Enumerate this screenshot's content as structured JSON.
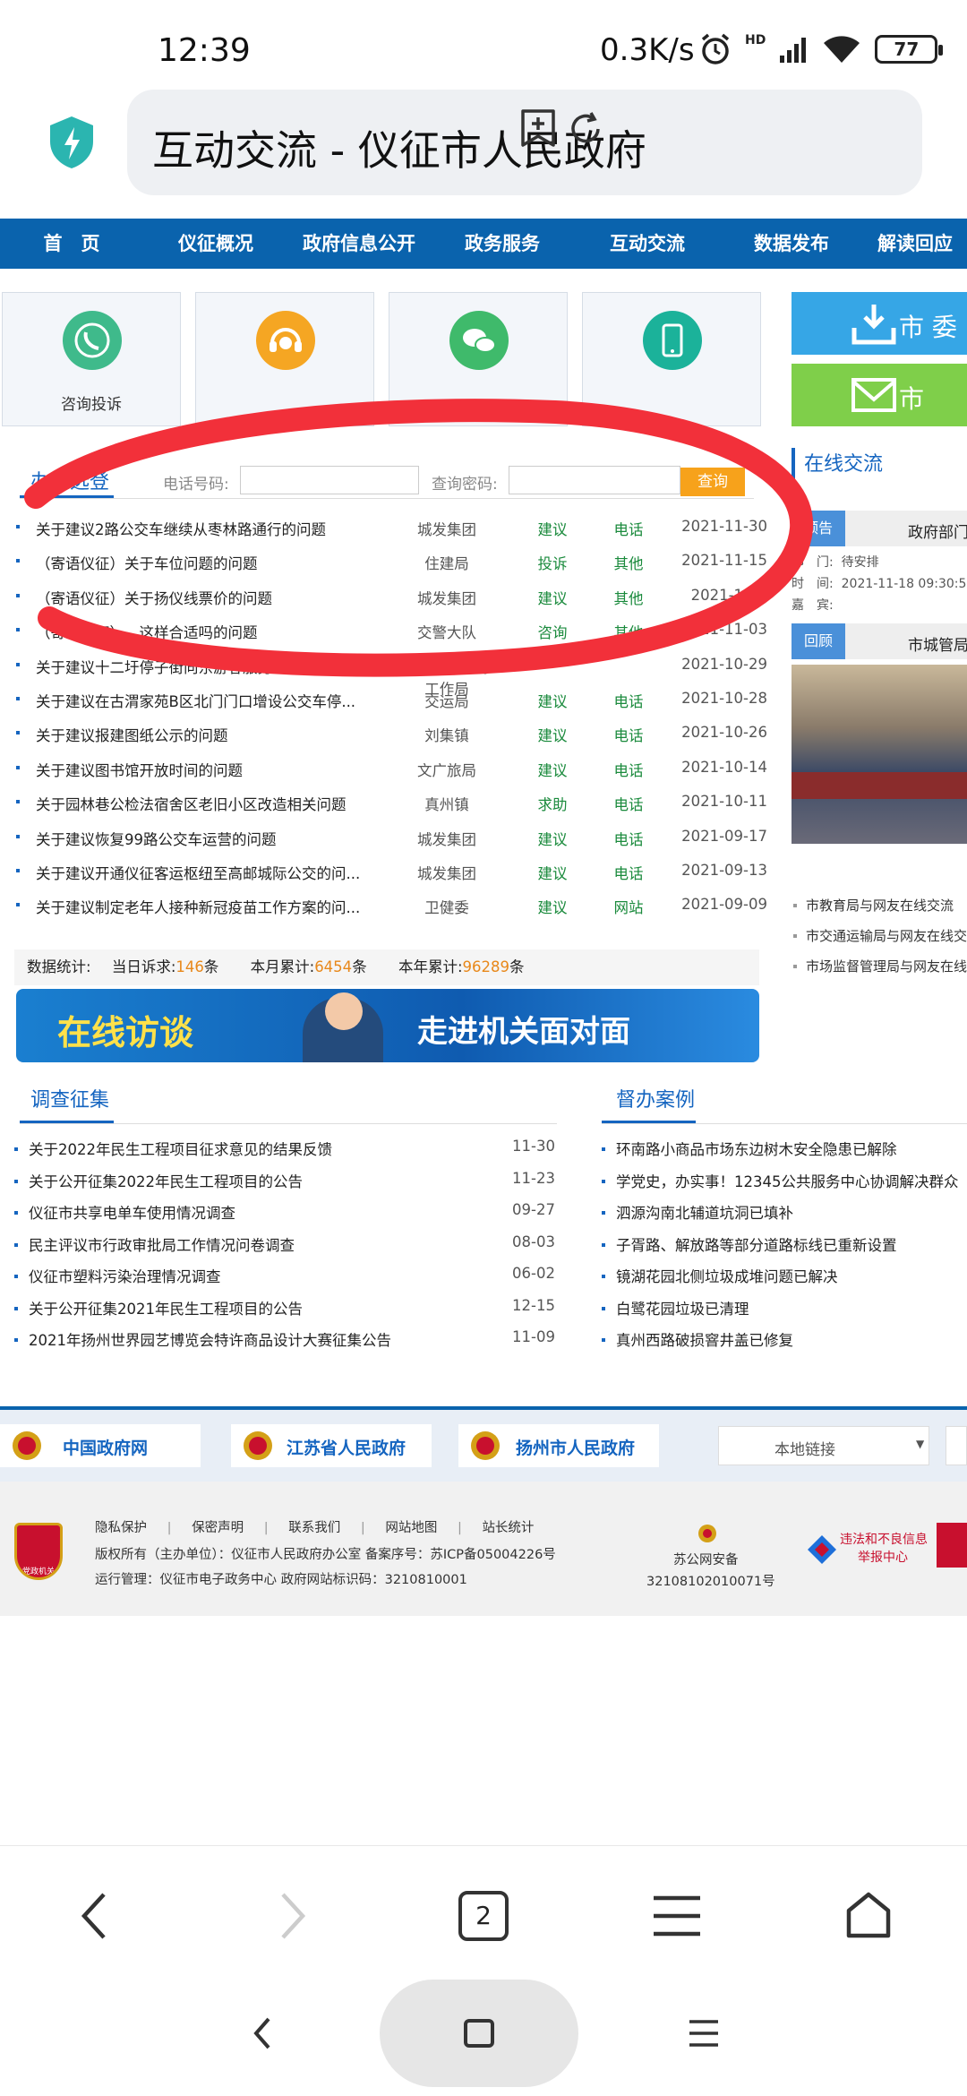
{
  "status": {
    "time": "12:39",
    "net_speed": "0.3K/s",
    "hd": "HD",
    "battery": "77"
  },
  "browser": {
    "title": "互动交流 - 仪征市人民政府",
    "tab_count": "2"
  },
  "nav": [
    "首　页",
    "仪征概况",
    "政府信息公开",
    "政务服务",
    "互动交流",
    "数据发布",
    "解读回应"
  ],
  "tiles": [
    {
      "label": "咨询投诉",
      "color": "#3fba8b"
    },
    {
      "label": "",
      "color": "#f5a623"
    },
    {
      "label": "",
      "color": "#3fba6b"
    },
    {
      "label": "",
      "color": "#1bb29a"
    }
  ],
  "side_buttons": [
    {
      "label": "市 委",
      "color": "#36a6e6"
    },
    {
      "label": "市",
      "color": "#7fcf4a"
    }
  ],
  "office": {
    "title": "办件选登",
    "phone_label": "电话号码:",
    "pwd_label": "查询密码:",
    "query_button": "查询",
    "rows": [
      {
        "title": "关于建议2路公交车继续从枣林路通行的问题",
        "dept": "城发集团",
        "type": "建议",
        "channel": "电话",
        "date": "2021-11-30"
      },
      {
        "title": "（寄语仪征）关于车位问题的问题",
        "dept": "住建局",
        "type": "投诉",
        "channel": "其他",
        "date": "2021-11-15"
      },
      {
        "title": "（寄语仪征）关于扬仪线票价的问题",
        "dept": "城发集团",
        "type": "建议",
        "channel": "其他",
        "date": "2021-11-1"
      },
      {
        "title": "（寄语仪征）…这样合适吗的问题",
        "dept": "交警大队",
        "type": "咨询",
        "channel": "其他",
        "date": "2021-11-03"
      },
      {
        "title": "关于建议十二圩停子街向东游客服务中心…",
        "dept": "开发区十二圩工作局",
        "type": "",
        "channel": "",
        "date": "2021-10-29"
      },
      {
        "title": "关于建议在古渭家苑B区北门门口增设公交车停...",
        "dept": "交运局",
        "type": "建议",
        "channel": "电话",
        "date": "2021-10-28"
      },
      {
        "title": "关于建议报建图纸公示的问题",
        "dept": "刘集镇",
        "type": "建议",
        "channel": "电话",
        "date": "2021-10-26"
      },
      {
        "title": "关于建议图书馆开放时间的问题",
        "dept": "文广旅局",
        "type": "建议",
        "channel": "电话",
        "date": "2021-10-14"
      },
      {
        "title": "关于园林巷公检法宿舍区老旧小区改造相关问题",
        "dept": "真州镇",
        "type": "求助",
        "channel": "电话",
        "date": "2021-10-11"
      },
      {
        "title": "关于建议恢复99路公交车运营的问题",
        "dept": "城发集团",
        "type": "建议",
        "channel": "电话",
        "date": "2021-09-17"
      },
      {
        "title": "关于建议开通仪征客运枢纽至高邮城际公交的问...",
        "dept": "城发集团",
        "type": "建议",
        "channel": "电话",
        "date": "2021-09-13"
      },
      {
        "title": "关于建议制定老年人接种新冠疫苗工作方案的问...",
        "dept": "卫健委",
        "type": "建议",
        "channel": "网站",
        "date": "2021-09-09"
      }
    ],
    "stats_label": "数据统计:",
    "today_label": "当日诉求:",
    "today": "146",
    "unit": "条",
    "month_label": "本月累计:",
    "month": "6454",
    "year_label": "本年累计:",
    "year": "96289"
  },
  "banner": {
    "left": "在线访谈",
    "right": "走进机关面对面"
  },
  "online": {
    "title": "在线交流",
    "notice_tag": "预告",
    "notice_title": "政府部门",
    "dept_label": "部　门:",
    "dept_value": "待安排",
    "time_label": "时　间:",
    "time_value": "2021-11-18 09:30:5",
    "guest_label": "嘉　宾:",
    "review_tag": "回顾",
    "review_title": "市城管局",
    "items": [
      "市教育局与网友在线交流",
      "市交通运输局与网友在线交",
      "市场监督管理局与网友在线"
    ]
  },
  "survey": {
    "title": "调查征集",
    "items": [
      {
        "t": "关于2022年民生工程项目征求意见的结果反馈",
        "d": "11-30"
      },
      {
        "t": "关于公开征集2022年民生工程项目的公告",
        "d": "11-23"
      },
      {
        "t": "仪征市共享电单车使用情况调查",
        "d": "09-27"
      },
      {
        "t": "民主评议市行政审批局工作情况问卷调查",
        "d": "08-03"
      },
      {
        "t": "仪征市塑料污染治理情况调查",
        "d": "06-02"
      },
      {
        "t": "关于公开征集2021年民生工程项目的公告",
        "d": "12-15"
      },
      {
        "t": "2021年扬州世界园艺博览会特许商品设计大赛征集公告",
        "d": "11-09"
      }
    ]
  },
  "cases": {
    "title": "督办案例",
    "items": [
      "环南路小商品市场东边树木安全隐患已解除",
      "学党史，办实事！12345公共服务中心协调解决群众",
      "泗源沟南北辅道坑洞已填补",
      "子胥路、解放路等部分道路标线已重新设置",
      "镜湖花园北侧垃圾成堆问题已解决",
      "白鹭花园垃圾已清理",
      "真州西路破损窨井盖已修复"
    ]
  },
  "gov_links": [
    "中国政府网",
    "江苏省人民政府",
    "扬州市人民政府"
  ],
  "local_links": "本地链接",
  "footer": {
    "links": [
      "隐私保护",
      "保密声明",
      "联系我们",
      "网站地图",
      "站长统计"
    ],
    "copyright": "版权所有（主办单位）：仪征市人民政府办公室  备案序号：苏ICP备05004226号",
    "ops": "运行管理：仪征市电子政务中心  政府网站标识码：3210810001",
    "police_name": "苏公网安备",
    "police_no": "32108102010071号",
    "report_line1": "违法和不良信息",
    "report_line2": "举报中心",
    "badge_text": "党政机关"
  }
}
